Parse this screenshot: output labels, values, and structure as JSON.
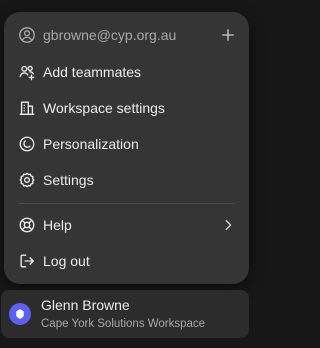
{
  "menu": {
    "email": "gbrowne@cyp.org.au",
    "items": [
      {
        "label": "Add teammates",
        "icon": "add-teammates-icon"
      },
      {
        "label": "Workspace settings",
        "icon": "building-icon"
      },
      {
        "label": "Personalization",
        "icon": "personalization-icon"
      },
      {
        "label": "Settings",
        "icon": "gear-icon"
      },
      {
        "label": "Help",
        "icon": "lifebuoy-icon"
      },
      {
        "label": "Log out",
        "icon": "logout-icon"
      }
    ]
  },
  "user": {
    "name": "Glenn Browne",
    "workspace": "Cape York Solutions Workspace",
    "avatar_color": "#5b5ff2"
  },
  "colors": {
    "menu_bg": "#353535",
    "page_bg": "#171717",
    "text": "#ececec",
    "muted_text": "#a9a9a9"
  }
}
